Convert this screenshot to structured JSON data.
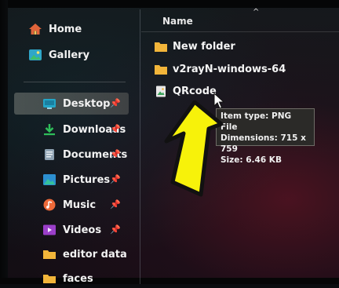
{
  "sidebar": {
    "top_items": [
      {
        "label": "Home",
        "icon": "home-icon"
      },
      {
        "label": "Gallery",
        "icon": "gallery-icon"
      }
    ],
    "pinned_items": [
      {
        "label": "Desktop",
        "icon": "desktop-icon"
      },
      {
        "label": "Downloads",
        "icon": "download-icon"
      },
      {
        "label": "Documents",
        "icon": "documents-icon"
      },
      {
        "label": "Pictures",
        "icon": "pictures-icon"
      },
      {
        "label": "Music",
        "icon": "music-icon"
      },
      {
        "label": "Videos",
        "icon": "videos-icon"
      }
    ],
    "folders": [
      {
        "label": "editor data",
        "icon": "folder-icon"
      },
      {
        "label": "faces",
        "icon": "folder-icon"
      }
    ],
    "selected": "Desktop"
  },
  "list": {
    "column_name": "Name",
    "files": [
      {
        "name": "New folder",
        "type": "folder"
      },
      {
        "name": "v2rayN-windows-64",
        "type": "folder"
      },
      {
        "name": "QRcode",
        "type": "png"
      }
    ]
  },
  "tooltip": {
    "line1": "Item type: PNG File",
    "line2": "Dimensions: 715 x 759",
    "line3": "Size: 6.46 KB"
  },
  "colors": {
    "folder": "#f2b53a",
    "arrow_fill": "#f7f20a",
    "arrow_stroke": "#111111",
    "selected_bg": "#7a7d78"
  }
}
